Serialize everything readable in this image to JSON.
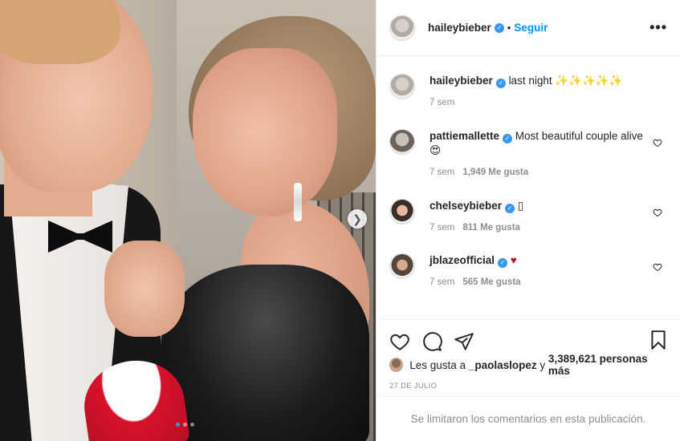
{
  "post": {
    "image_alt": "",
    "carousel": {
      "count": 3,
      "active": 0
    }
  },
  "header": {
    "username": "haileybieber",
    "follow_label": "Seguir",
    "separator": "•",
    "more_label": "•••"
  },
  "comments": [
    {
      "username": "haileybieber",
      "text": "last night ✨✨✨✨✨",
      "time": "7 sem",
      "likes": ""
    },
    {
      "username": "pattiemallette",
      "text": "Most beautiful couple alive 😍",
      "time": "7 sem",
      "likes": "1,949 Me gusta"
    },
    {
      "username": "chelseybieber",
      "text": "▯",
      "time": "7 sem",
      "likes": "811 Me gusta"
    },
    {
      "username": "jblazeofficial",
      "text": "♥",
      "time": "7 sem",
      "likes": "565 Me gusta"
    }
  ],
  "likes": {
    "prefix": "Les gusta a ",
    "user": "_paolaslopez",
    "middle": " y ",
    "count": "3,389,621 personas más"
  },
  "date": "27 DE JULIO",
  "comments_limited": "Se limitaron los comentarios en esta publicación.",
  "colors": {
    "accent": "#0095f6",
    "verified": "#3897f0",
    "muted": "#8e8e8e",
    "heart_red": "#ae1b2b"
  },
  "icons": [
    "verified-icon",
    "more-icon",
    "heart-icon",
    "comment-icon",
    "share-icon",
    "bookmark-icon",
    "next-arrow-icon"
  ]
}
